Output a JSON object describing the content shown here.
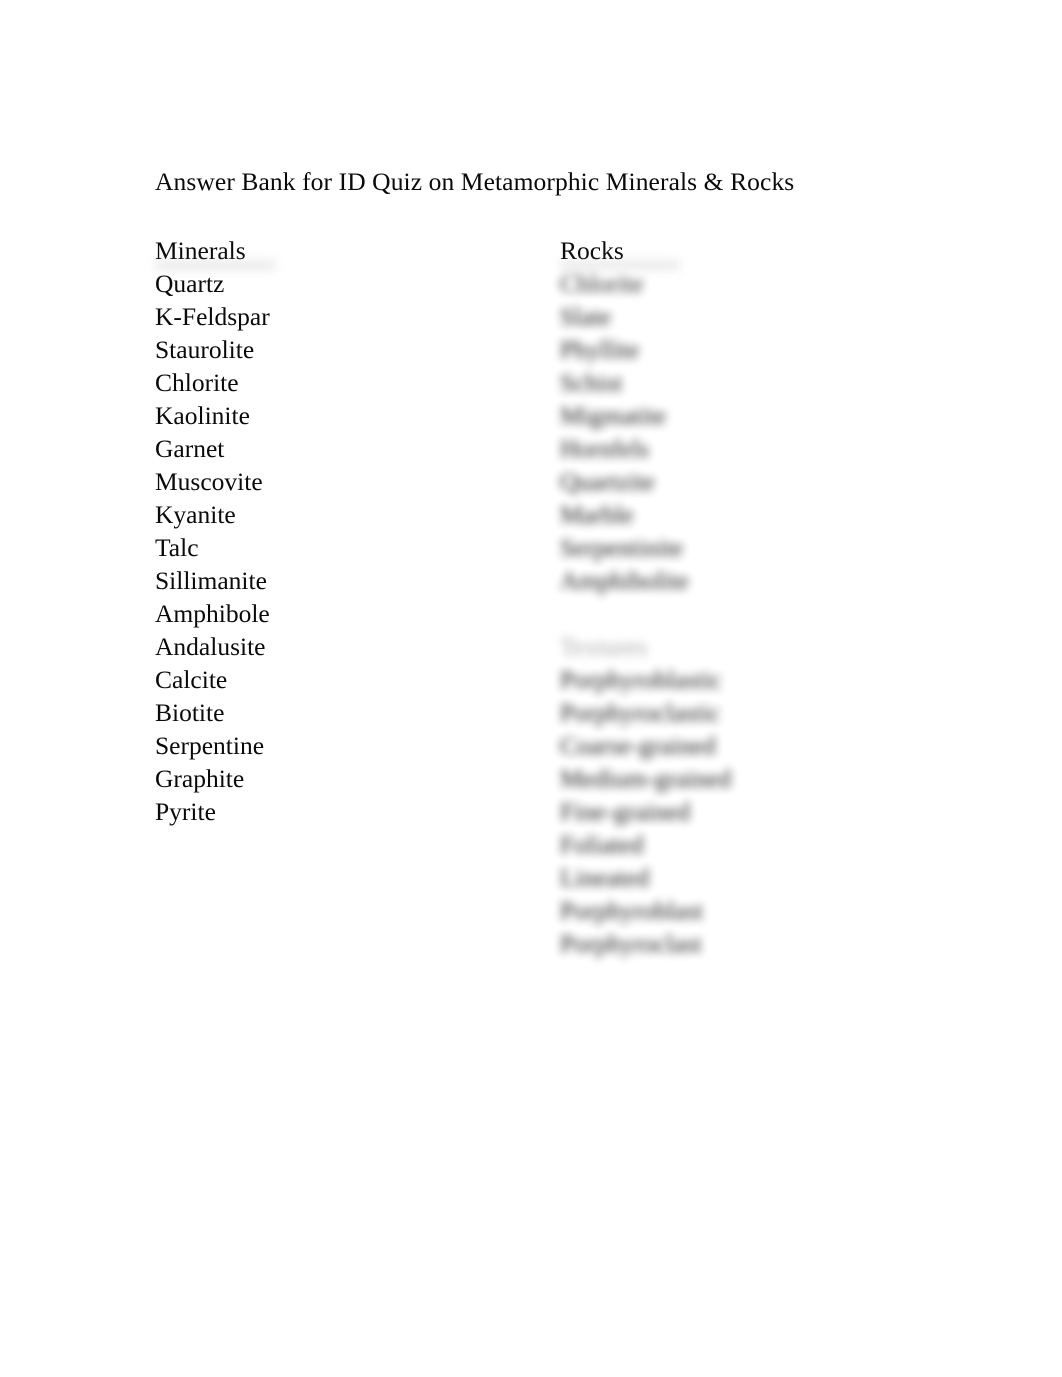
{
  "document": {
    "title": "Answer Bank for ID Quiz on Metamorphic Minerals & Rocks"
  },
  "columns": {
    "minerals": {
      "heading": "Minerals",
      "items": [
        "Quartz",
        "K-Feldspar",
        "Staurolite",
        "Chlorite",
        "Kaolinite",
        "Garnet",
        "Muscovite",
        "Kyanite",
        "Talc",
        "Sillimanite",
        "Amphibole",
        "Andalusite",
        "Calcite",
        "Biotite",
        "Serpentine",
        "Graphite",
        "Pyrite"
      ]
    },
    "rocks": {
      "heading": "Rocks",
      "items": [
        "Chlorite",
        "Slate",
        "Phyllite",
        "Schist",
        "Migmatite",
        "Hornfels",
        "Quartzite",
        "Marble",
        "Serpentinite",
        "Amphibolite"
      ],
      "textures": {
        "heading": "Textures",
        "items": [
          "Porphyroblastic",
          "Porphyroclastic",
          "Coarse-grained",
          "Medium-grained",
          "Fine-grained",
          "Foliated",
          "Lineated",
          "Porphyroblast",
          "Porphyroclast"
        ]
      }
    }
  }
}
